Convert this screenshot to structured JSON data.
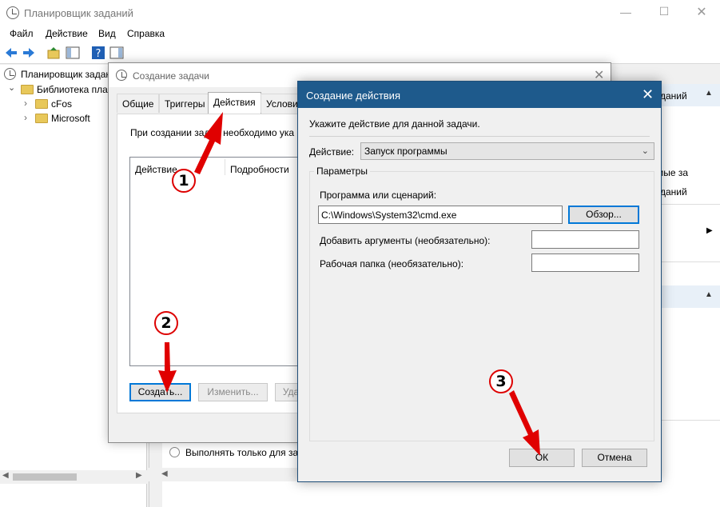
{
  "main_window": {
    "title": "Планировщик заданий",
    "menu": [
      "Файл",
      "Действие",
      "Вид",
      "Справка"
    ],
    "tree": {
      "root": "Планировщик заданий",
      "library": "Библиотека пла",
      "items": [
        "cFos",
        "Microsoft"
      ]
    },
    "right_pane": {
      "actions_header": "даний",
      "item1": "мые за",
      "item2": "даний"
    },
    "bottom_option": "Выполнять только для зар"
  },
  "task_dialog": {
    "title": "Создание задачи",
    "tabs": [
      "Общие",
      "Триггеры",
      "Действия",
      "Услови"
    ],
    "description": "При создании зад     необходимо ука",
    "columns": [
      "Действие",
      "Подробности"
    ],
    "buttons": {
      "create": "Создать...",
      "edit": "Изменить...",
      "delete": "Уда"
    }
  },
  "action_dialog": {
    "title": "Создание действия",
    "prompt": "Укажите действие для данной задачи.",
    "action_label": "Действие:",
    "action_value": "Запуск программы",
    "params_label": "Параметры",
    "program_label": "Программа или сценарий:",
    "program_value": "C:\\Windows\\System32\\cmd.exe",
    "browse": "Обзор...",
    "args_label": "Добавить аргументы (необязательно):",
    "workdir_label": "Рабочая папка (необязательно):",
    "ok": "ОК",
    "cancel": "Отмена"
  },
  "annotations": {
    "step1": "1",
    "step2": "2",
    "step3": "3",
    "color": "#e00000"
  }
}
